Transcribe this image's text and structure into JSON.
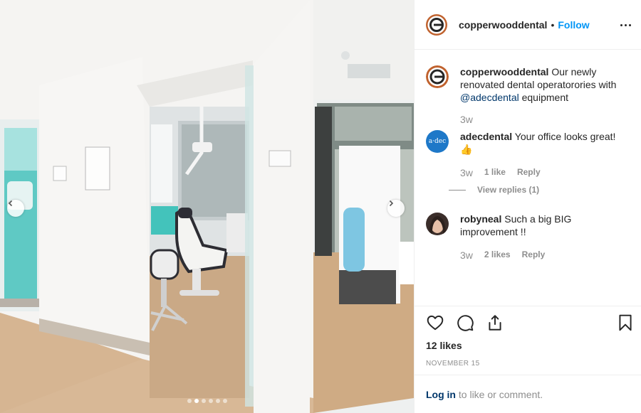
{
  "header": {
    "username": "copperwooddental",
    "separator": "•",
    "follow_label": "Follow"
  },
  "caption": {
    "username": "copperwooddental",
    "text_before": "Our newly renovated dental operatorories with",
    "mention": "@adecdental",
    "text_after": "equipment",
    "time": "3w"
  },
  "comments": [
    {
      "username": "adecdental",
      "avatar_text": "a·dec",
      "text": "Your office looks great!",
      "emoji": "👍",
      "time": "3w",
      "likes": "1 like",
      "reply_label": "Reply",
      "view_replies": "View replies (1)"
    },
    {
      "username": "robyneal",
      "text": "Such a big BIG improvement !!",
      "time": "3w",
      "likes": "2 likes",
      "reply_label": "Reply"
    }
  ],
  "actions": {
    "like_icon": "heart-icon",
    "comment_icon": "comment-icon",
    "share_icon": "share-icon",
    "save_icon": "bookmark-icon"
  },
  "likes_count": "12 likes",
  "date": "NOVEMBER 15",
  "login": {
    "link_label": "Log in",
    "text": "to like or comment."
  },
  "carousel": {
    "slide_count": 6,
    "active_index": 1
  },
  "colors": {
    "follow": "#0095f6",
    "link": "#00376b",
    "muted": "#8e8e8e",
    "brand_copper": "#c0622e",
    "adec_blue": "#1e78c8"
  }
}
